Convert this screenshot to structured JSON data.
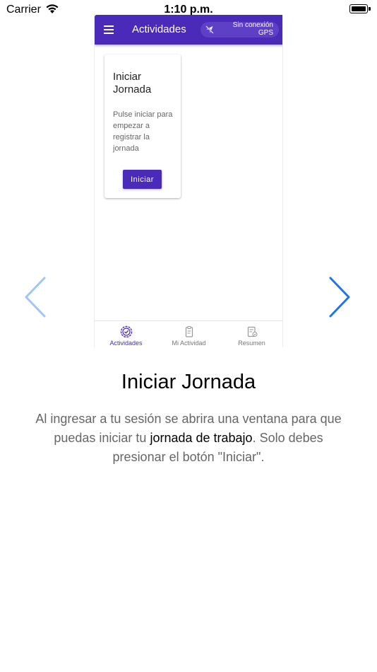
{
  "status_bar": {
    "carrier": "Carrier",
    "time": "1:10 p.m."
  },
  "app": {
    "title": "Actividades",
    "gps_status": "Sin conexión GPS",
    "card": {
      "title": "Iniciar Jornada",
      "text": "Pulse iniciar para empezar a registrar la jornada",
      "button": "Iniciar"
    },
    "bottom_nav": [
      {
        "label": "Actividades",
        "icon": "check-circle-icon",
        "active": true
      },
      {
        "label": "Mi Actividad",
        "icon": "clipboard-icon",
        "active": false
      },
      {
        "label": "Resumen",
        "icon": "summary-icon",
        "active": false
      }
    ],
    "colors": {
      "primary": "#4a2ab8",
      "arrow_active": "#1f74e8",
      "arrow_faded": "#9ec7f3"
    }
  },
  "slide": {
    "title": "Iniciar Jornada",
    "desc_part1": "Al ingresar a tu sesión se abrira una ventana para que puedas iniciar tu ",
    "desc_bold": "jornada de trabajo",
    "desc_part2": ". Solo debes presionar el botón \"Iniciar\"."
  },
  "carousel": {
    "prev_icon": "chevron-left-icon",
    "next_icon": "chevron-right-icon"
  }
}
